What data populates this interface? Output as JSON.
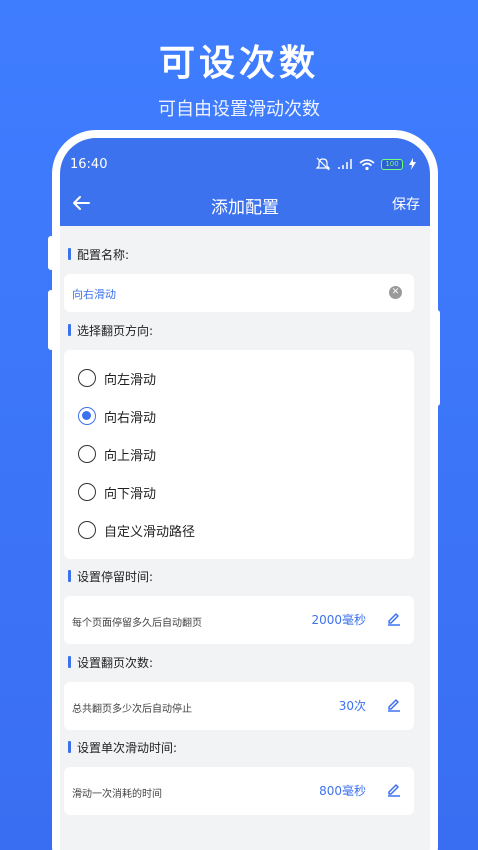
{
  "promo": {
    "title": "可设次数",
    "subtitle": "可自由设置滑动次数"
  },
  "status_bar": {
    "time": "16:40",
    "battery": "100"
  },
  "header": {
    "title": "添加配置",
    "save_label": "保存"
  },
  "config_name": {
    "label": "配置名称:",
    "value": "向右滑动"
  },
  "direction": {
    "label": "选择翻页方向:",
    "options": [
      "向左滑动",
      "向右滑动",
      "向上滑动",
      "向下滑动",
      "自定义滑动路径"
    ],
    "selected": "向右滑动"
  },
  "stay_time": {
    "label": "设置停留时间:",
    "description": "每个页面停留多久后自动翻页",
    "value": "2000毫秒"
  },
  "page_count": {
    "label": "设置翻页次数:",
    "description": "总共翻页多少次后自动停止",
    "value": "30次"
  },
  "swipe_time": {
    "label": "设置单次滑动时间:",
    "description": "滑动一次消耗的时间",
    "value": "800毫秒"
  },
  "colors": {
    "accent": "#3d72ef",
    "background": "#3f7dff"
  }
}
